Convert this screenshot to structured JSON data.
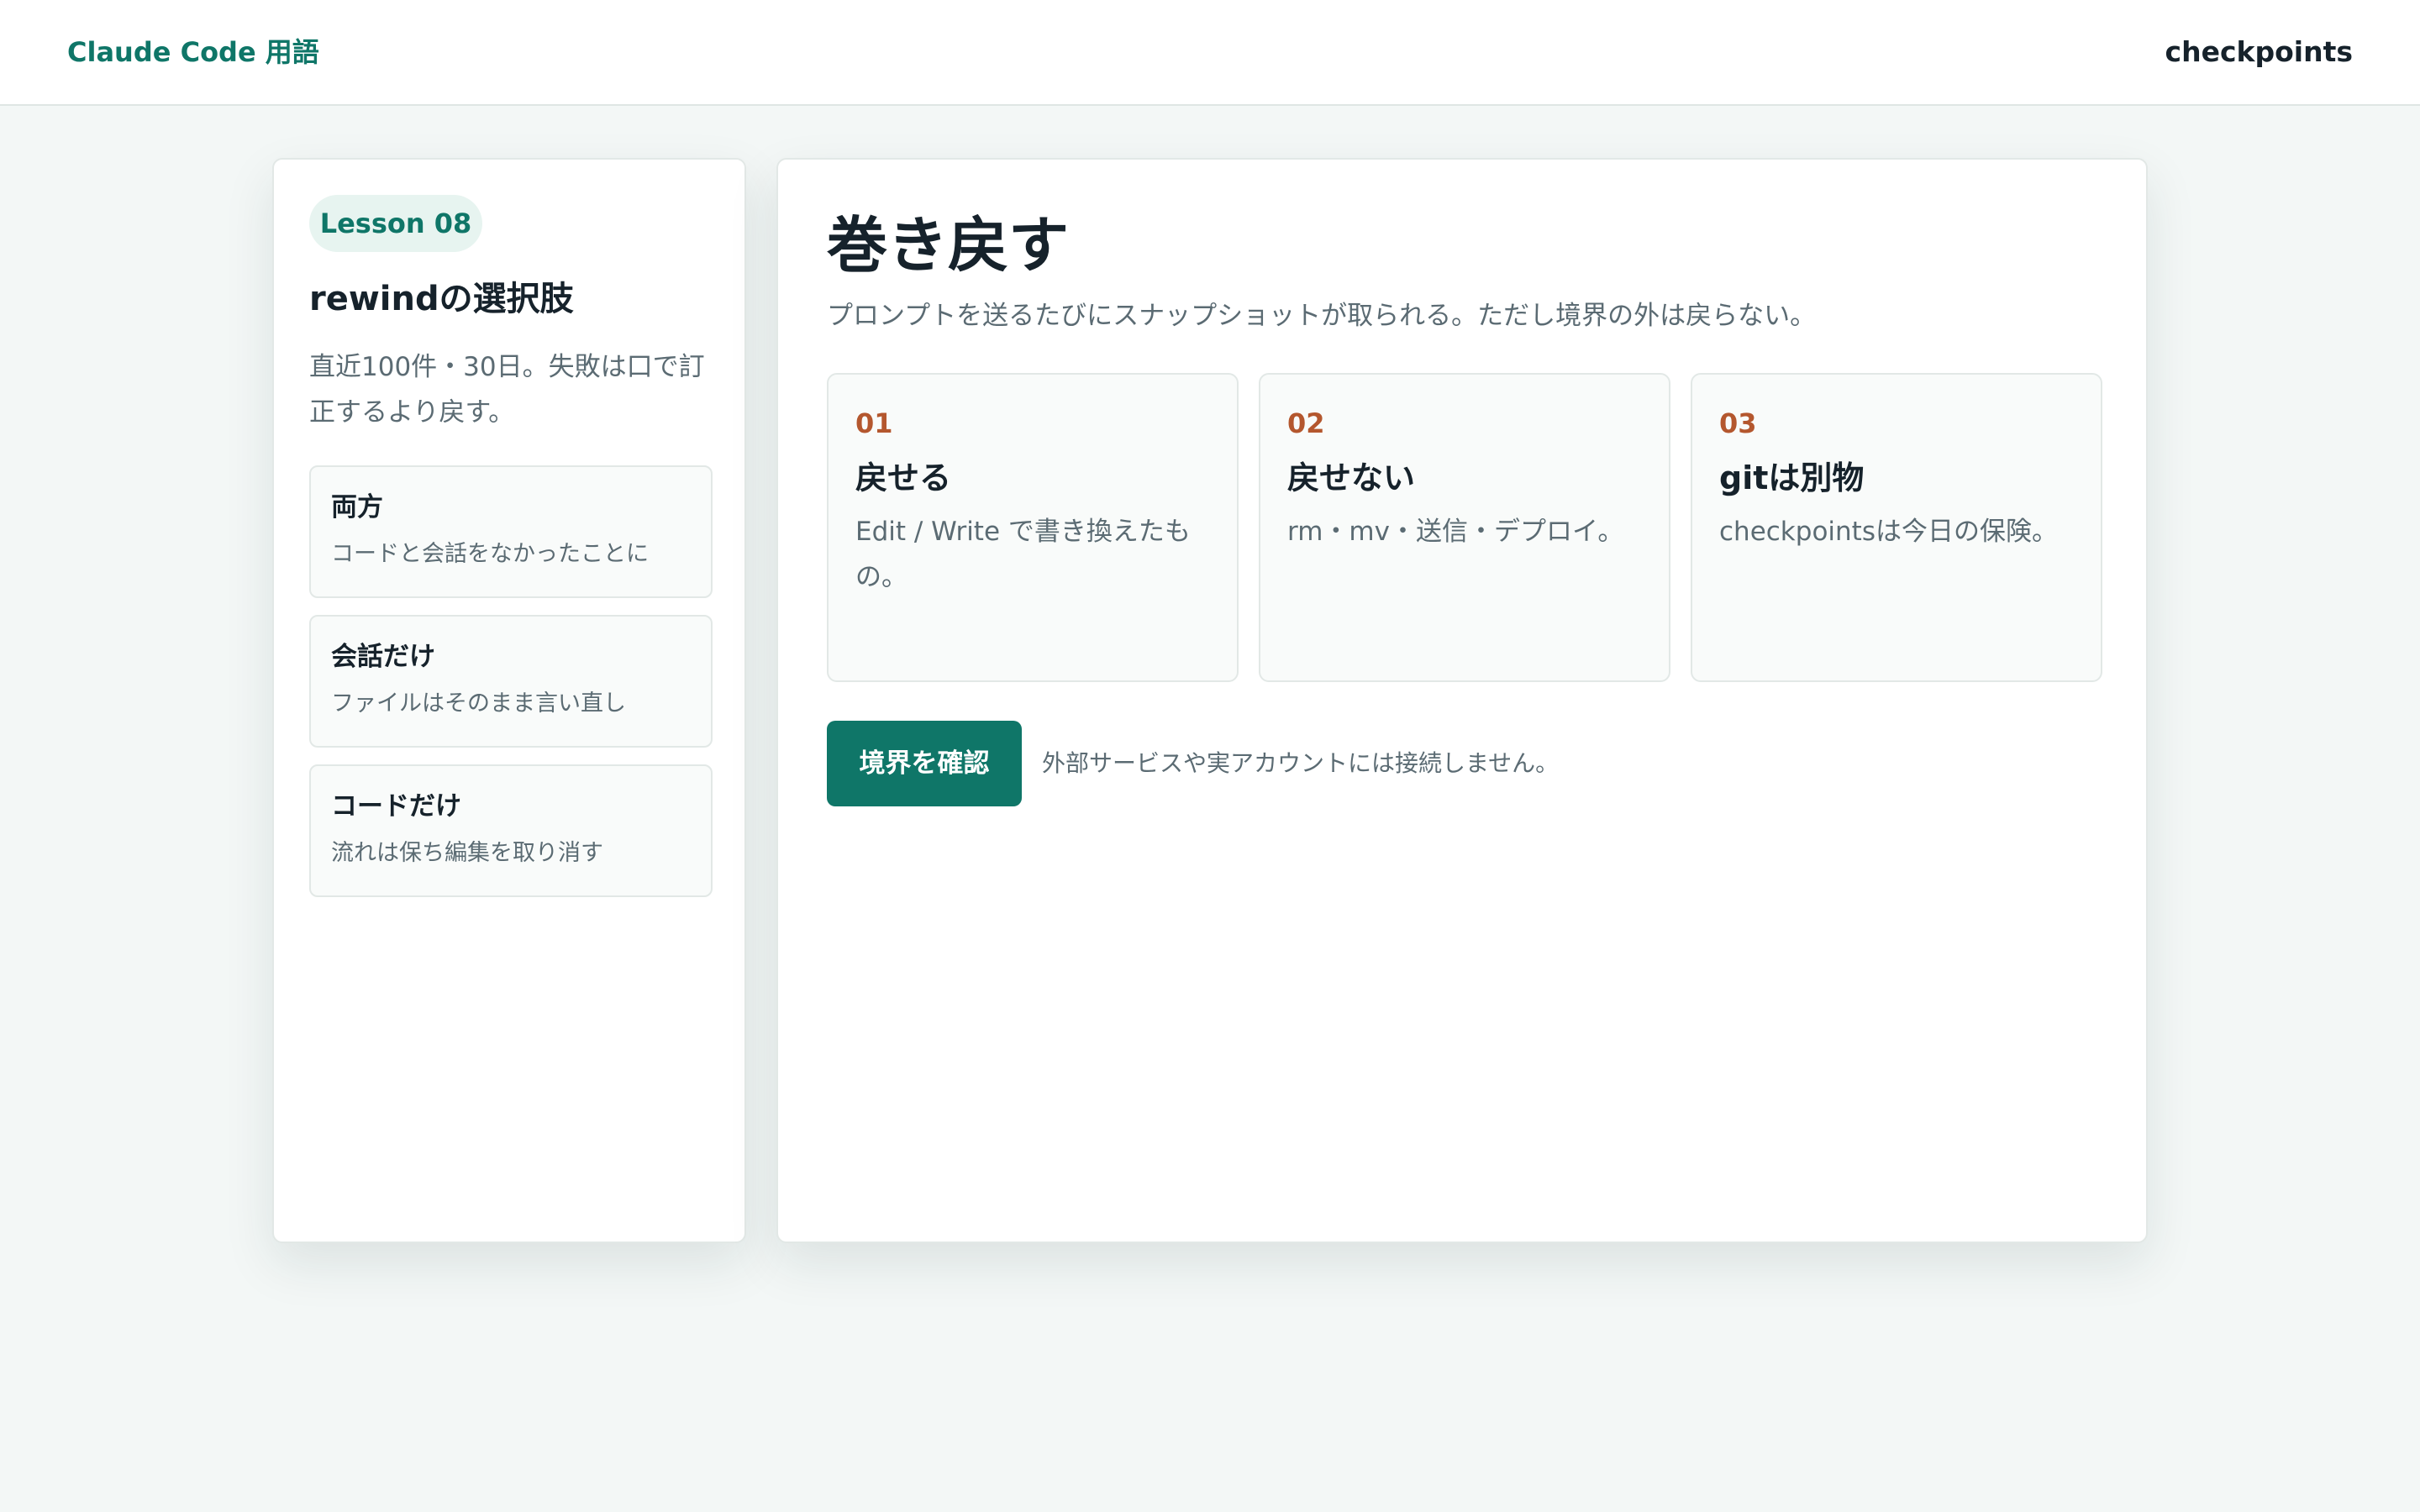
{
  "header": {
    "brand": "Claude Code 用語",
    "topic": "checkpoints"
  },
  "sidebar": {
    "badge": "Lesson 08",
    "title": "rewindの選択肢",
    "description": "直近100件・30日。失敗は口で訂正するより戻す。",
    "options": [
      {
        "title": "両方",
        "subtitle": "コードと会話をなかったことに"
      },
      {
        "title": "会話だけ",
        "subtitle": "ファイルはそのまま言い直し"
      },
      {
        "title": "コードだけ",
        "subtitle": "流れは保ち編集を取り消す"
      }
    ]
  },
  "main": {
    "title": "巻き戻す",
    "description": "プロンプトを送るたびにスナップショットが取られる。ただし境界の外は戻らない。",
    "cards": [
      {
        "num": "01",
        "title": "戻せる",
        "text": "Edit / Write で書き換えたもの。"
      },
      {
        "num": "02",
        "title": "戻せない",
        "text": "rm・mv・送信・デプロイ。"
      },
      {
        "num": "03",
        "title": "gitは別物",
        "text": "checkpointsは今日の保険。"
      }
    ],
    "action_label": "境界を確認",
    "action_note": "外部サービスや実アカウントには接続しません。"
  },
  "colors": {
    "accent": "#0f7668",
    "number": "#b4572e",
    "background": "#f3f7f6"
  }
}
